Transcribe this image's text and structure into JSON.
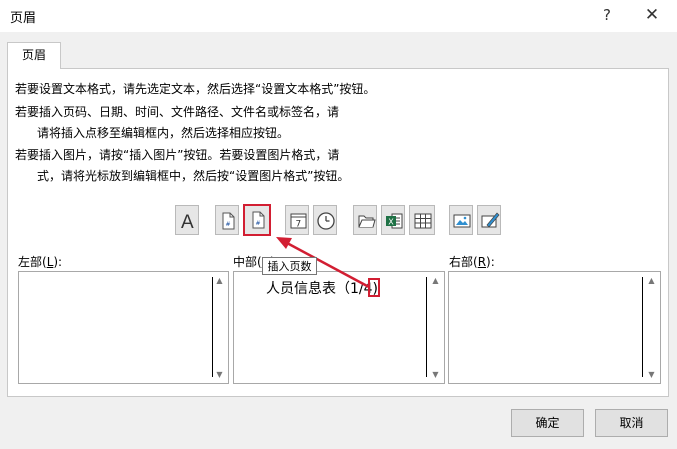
{
  "window": {
    "title": "页眉",
    "help": "?",
    "close": "✕"
  },
  "tab": {
    "label": "页眉"
  },
  "instructions": [
    "若要设置文本格式，请先选定文本，然后选择“设置文本格式”按钮。",
    "若要插入页码、日期、时间、文件路径、文件名或标签名，请",
    "请将插入点移至编辑框内，然后选择相应按钮。",
    "若要插入图片，请按“插入图片”按钮。若要设置图片格式，请",
    "式，请将光标放到编辑框中，然后按“设置图片格式”按钮。"
  ],
  "toolbar": {
    "tooltip": "插入页数",
    "buttons": [
      {
        "icon": "format-text-icon"
      },
      {
        "icon": "insert-page-number-icon"
      },
      {
        "icon": "insert-number-of-pages-icon",
        "active": true
      },
      {
        "icon": "insert-date-icon",
        "glyph": "7"
      },
      {
        "icon": "insert-time-icon"
      },
      {
        "icon": "insert-file-path-icon"
      },
      {
        "icon": "insert-file-name-icon",
        "glyph": "X"
      },
      {
        "icon": "insert-sheet-name-icon"
      },
      {
        "icon": "insert-picture-icon"
      },
      {
        "icon": "format-picture-icon"
      }
    ]
  },
  "sections": {
    "left": {
      "label_prefix": "左部(",
      "label_key": "L",
      "label_suffix": "):",
      "content": ""
    },
    "center": {
      "label_prefix": "中部(",
      "label_key": "C",
      "label_suffix": "):",
      "content": "人员信息表（1/4)"
    },
    "right": {
      "label_prefix": "右部(",
      "label_key": "R",
      "label_suffix": "):",
      "content": ""
    }
  },
  "buttons": {
    "ok": "确定",
    "cancel": "取消"
  },
  "colors": {
    "highlight": "#d21e32",
    "excel_green": "#1e7145"
  }
}
